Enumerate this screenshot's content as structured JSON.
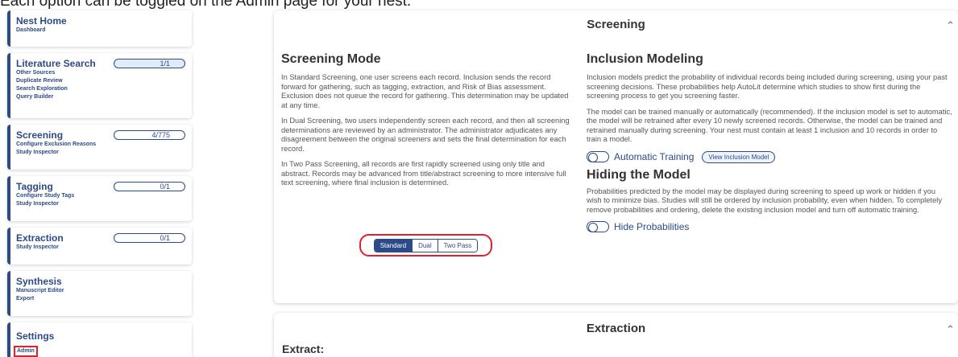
{
  "caption": "Each option can be toggled on the Admin page for your nest.",
  "sidebar": {
    "items": [
      {
        "title": "Nest Home",
        "pill": null,
        "subs": [
          "Dashboard"
        ]
      },
      {
        "title": "Literature Search",
        "pill": "1/1",
        "subs": [
          "Other Sources",
          "Duplicate Review",
          "Search Exploration",
          "Query Builder"
        ]
      },
      {
        "title": "Screening",
        "pill": "4/775",
        "subs": [
          "Configure Exclusion Reasons",
          "Study Inspector"
        ]
      },
      {
        "title": "Tagging",
        "pill": "0/1",
        "subs": [
          "Configure Study Tags",
          "Study Inspector"
        ]
      },
      {
        "title": "Extraction",
        "pill": "0/1",
        "subs": [
          "Study Inspector"
        ]
      },
      {
        "title": "Synthesis",
        "pill": null,
        "subs": [
          "Manuscript Editor",
          "Export"
        ]
      },
      {
        "title": "Settings",
        "pill": null,
        "subs": [
          "Admin"
        ]
      }
    ]
  },
  "screening_panel": {
    "title": "Screening",
    "mode": {
      "heading": "Screening Mode",
      "paragraphs": [
        "In Standard Screening, one user screens each record. Inclusion sends the record forward for gathering, such as tagging, extraction, and Risk of Bias assessment. Exclusion does not queue the record for gathering. This determination may be updated at any time.",
        "In Dual Screening, two users independently screen each record, and then all screening determinations are reviewed by an administrator. The administrator adjudicates any disagreement between the original screeners and sets the final determination for each record.",
        "In Two Pass Screening, all records are first rapidly screened using only title and abstract. Records may be advanced from title/abstract screening to more intensive full text screening, where final inclusion is determined."
      ],
      "options": [
        "Standard",
        "Dual",
        "Two Pass"
      ],
      "selected": "Standard"
    },
    "inclusion": {
      "heading": "Inclusion Modeling",
      "paragraphs": [
        "Inclusion models predict the probability of individual records being included during screening, using your past screening decisions. These probabilities help AutoLit determine which studies to show first during the screening process to get you screening faster.",
        "The model can be trained manually or automatically (recommended). If the inclusion model is set to automatic, the model will be retrained after every 10 newly screened records. Otherwise, the model can be trained and retrained manually during screening. Your nest must contain at least 1 inclusion and 10 records in order to train a model."
      ],
      "toggle_label": "Automatic Training",
      "view_button": "View Inclusion Model"
    },
    "hiding": {
      "heading": "Hiding the Model",
      "paragraph": "Probabilities predicted by the model may be displayed during screening to speed up work or hidden if you wish to minimize bias. Studies will still be ordered by inclusion probability, even when hidden. To completely remove probabilities and ordering, delete the existing inclusion model and turn off automatic training.",
      "toggle_label": "Hide Probabilities"
    }
  },
  "extraction_panel": {
    "title": "Extraction",
    "subheading": "Extract:"
  }
}
